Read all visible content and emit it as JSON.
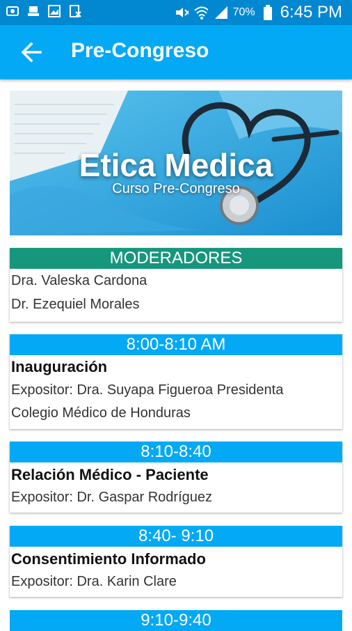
{
  "status": {
    "battery": "70%",
    "time": "6:45 PM"
  },
  "appbar": {
    "title": "Pre-Congreso"
  },
  "banner": {
    "title": "Etica Medica",
    "subtitle": "Curso Pre-Congreso"
  },
  "moderators": {
    "header": "MODERADORES",
    "names": [
      "Dra. Valeska Cardona",
      "Dr. Ezequiel Morales"
    ]
  },
  "sessions": [
    {
      "time": "8:00-8:10 AM",
      "title": "Inauguración",
      "speaker_line1": "Expositor: Dra. Suyapa Figueroa Presidenta",
      "speaker_line2": "Colegio Médico de Honduras"
    },
    {
      "time": "8:10-8:40",
      "title": "Relación Médico - Paciente",
      "speaker_line1": "Expositor: Dr. Gaspar Rodríguez"
    },
    {
      "time": "8:40- 9:10",
      "title": "Consentimiento Informado",
      "speaker_line1": "Expositor: Dra. Karin Clare"
    },
    {
      "time": "9:10-9:40"
    }
  ]
}
